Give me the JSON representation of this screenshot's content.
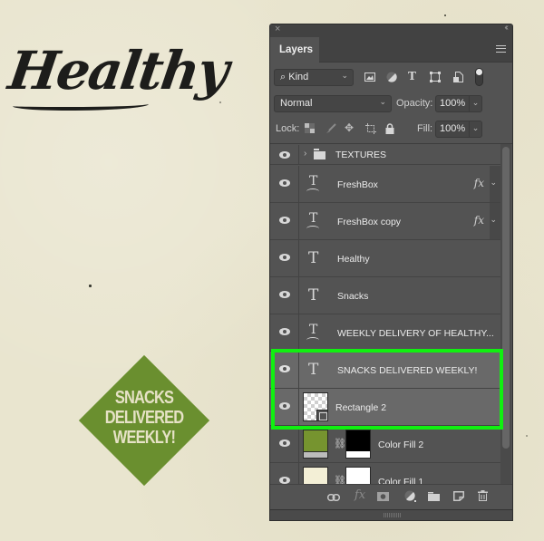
{
  "artwork": {
    "title": "Healthy",
    "badge_lines": [
      "SNACKS",
      "DELIVERED",
      "WEEKLY!"
    ],
    "badge_color": "#6a8f2f",
    "background_color": "#e9e5cf"
  },
  "panel": {
    "close_glyph": "×",
    "collapse_glyph": "‹‹",
    "tab_label": "Layers",
    "filter": {
      "kind_label": "Kind",
      "icons": [
        "pixel-filter-icon",
        "adjustment-filter-icon",
        "type-filter-icon",
        "shape-filter-icon",
        "smart-object-filter-icon",
        "filter-toggle"
      ]
    },
    "blend_mode": "Normal",
    "opacity_label": "Opacity:",
    "opacity_value": "100%",
    "lock_label": "Lock:",
    "fill_label": "Fill:",
    "fill_value": "100%",
    "layers": [
      {
        "name": "TEXTURES",
        "kind": "group",
        "visible": true
      },
      {
        "name": "FreshBox",
        "kind": "warped-text",
        "visible": true,
        "fx": "fx"
      },
      {
        "name": "FreshBox copy",
        "kind": "warped-text",
        "visible": true,
        "fx": "fx"
      },
      {
        "name": "Healthy",
        "kind": "text",
        "visible": true
      },
      {
        "name": "Snacks",
        "kind": "text",
        "visible": true
      },
      {
        "name": "WEEKLY DELIVERY OF HEALTHY...",
        "kind": "warped-text",
        "visible": true
      },
      {
        "name": "SNACKS DELIVERED WEEKLY!",
        "kind": "text",
        "visible": true,
        "selected": true
      },
      {
        "name": "Rectangle 2",
        "kind": "shape",
        "visible": true,
        "selected": true
      },
      {
        "name": "Color Fill 2",
        "kind": "fill",
        "visible": true,
        "fill_color": "#76942f"
      },
      {
        "name": "Color Fill 1",
        "kind": "fill",
        "visible": true,
        "fill_color": "#f3efd6"
      }
    ],
    "highlight_color": "#10f010",
    "footer_icons": [
      "link-layers-icon",
      "fx-icon",
      "add-mask-icon",
      "adjustment-layer-icon",
      "new-group-icon",
      "new-layer-icon",
      "delete-layer-icon"
    ]
  }
}
